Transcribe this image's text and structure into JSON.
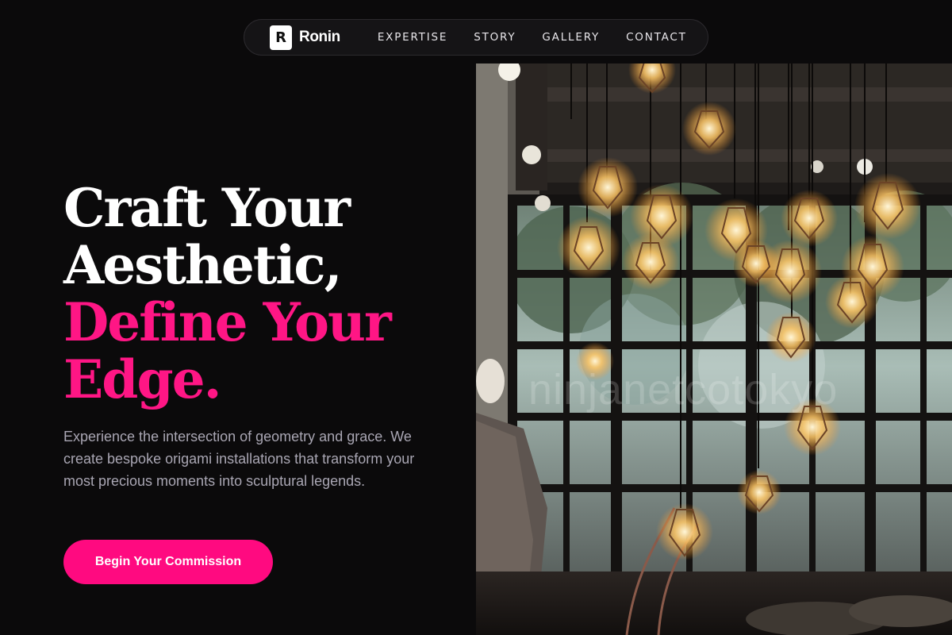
{
  "brand": {
    "logo_letter": "R",
    "name": "Ronin"
  },
  "nav": {
    "links": [
      "EXPERTISE",
      "STORY",
      "GALLERY",
      "CONTACT"
    ]
  },
  "hero": {
    "title_line1": "Craft Your",
    "title_line2": "Aesthetic,",
    "title_line3": "Define Your",
    "title_line4": "Edge.",
    "description": "Experience the intersection of geometry and grace. We create bespoke origami installations that transform your most precious moments into sculptural legends.",
    "cta_label": "Begin Your Commission"
  },
  "photo": {
    "watermark": "ninjanetcotokyo"
  },
  "colors": {
    "background": "#0b0a0b",
    "accent": "#ff0a80",
    "accent_text": "#ff1685",
    "body_text": "#a9a6b3"
  }
}
